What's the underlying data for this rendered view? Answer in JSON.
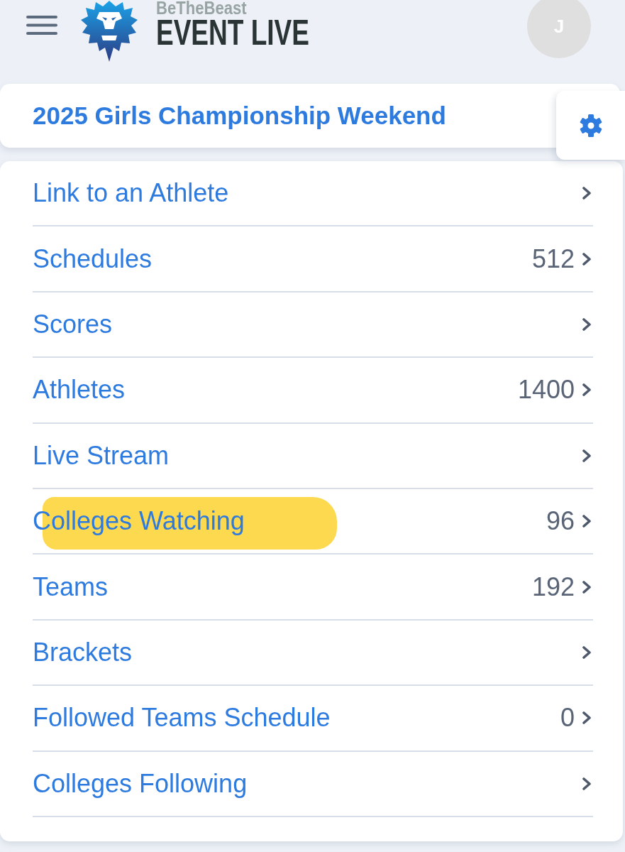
{
  "header": {
    "brand": "BeTheBeast",
    "product": "EVENT LIVE",
    "avatar_initial": "J"
  },
  "event": {
    "title": "2025 Girls Championship Weekend"
  },
  "menu": [
    {
      "label": "Link to an Athlete",
      "highlighted": false
    },
    {
      "label": "Schedules",
      "count": "512",
      "highlighted": false
    },
    {
      "label": "Scores",
      "highlighted": false
    },
    {
      "label": "Athletes",
      "count": "1400",
      "highlighted": false
    },
    {
      "label": "Live Stream",
      "highlighted": false
    },
    {
      "label": "Colleges Watching",
      "count": "96",
      "highlighted": true
    },
    {
      "label": "Teams",
      "count": "192",
      "highlighted": false
    },
    {
      "label": "Brackets",
      "highlighted": false
    },
    {
      "label": "Followed Teams Schedule",
      "count": "0",
      "highlighted": false
    },
    {
      "label": "Colleges Following",
      "highlighted": false
    }
  ]
}
